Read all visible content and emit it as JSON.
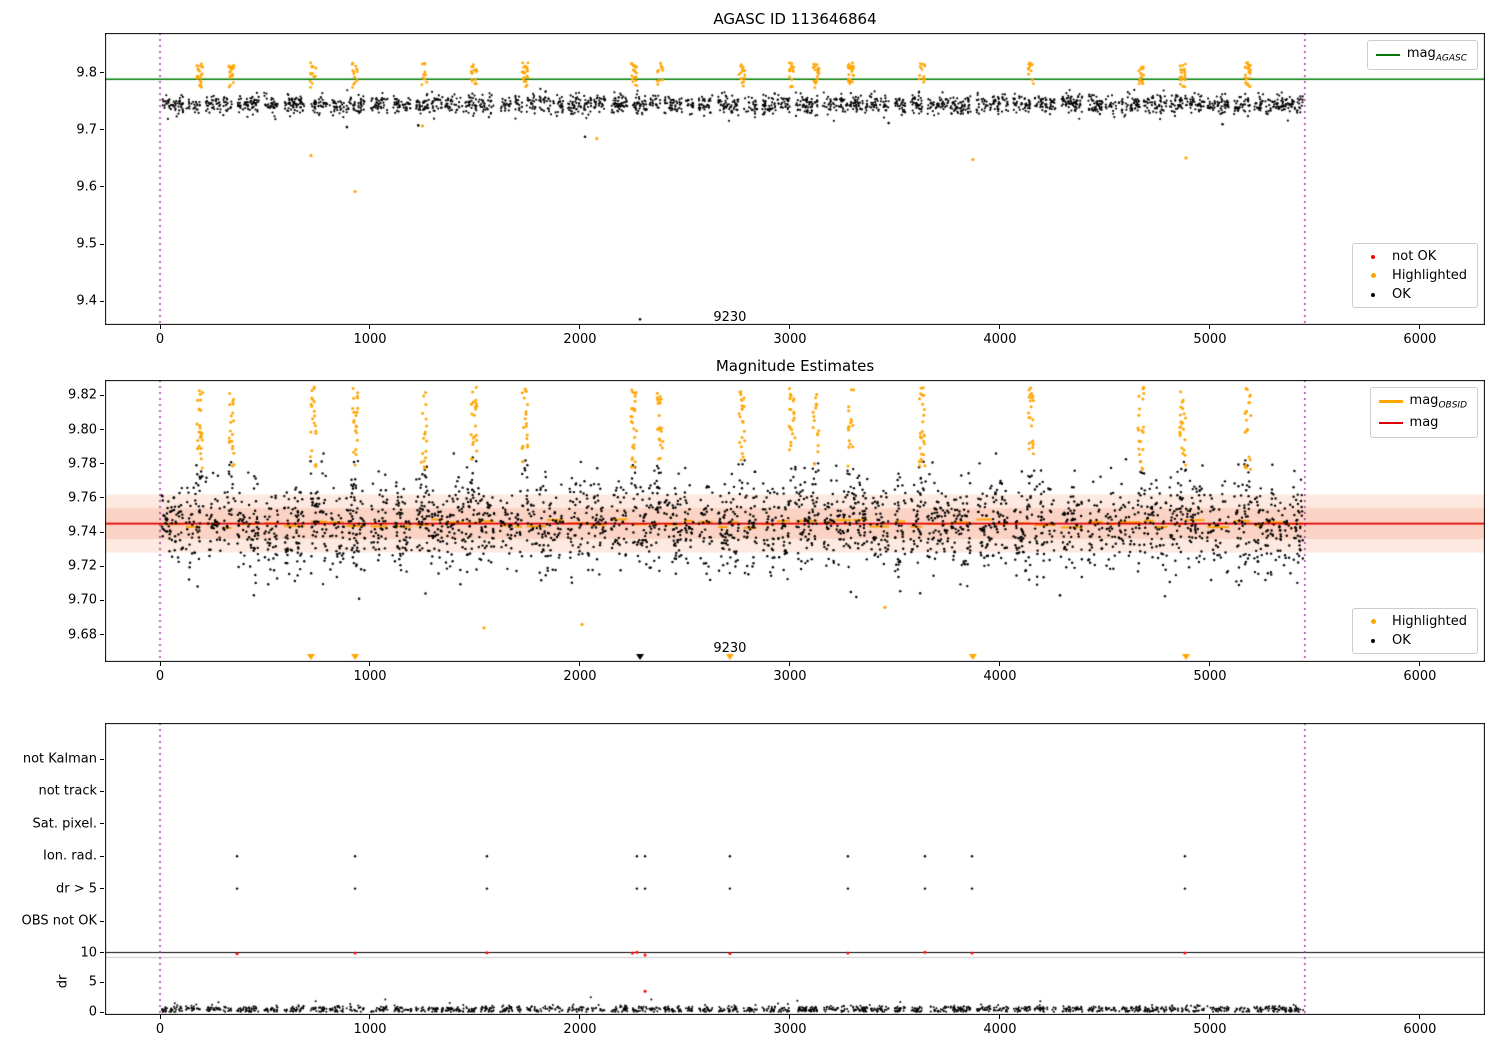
{
  "figure": {
    "background": "#ffffff"
  },
  "colors": {
    "ok_marker": "#000000",
    "highlighted_marker": "#ffa500",
    "not_ok_marker": "#ff0000",
    "agasc_line": "#007a00",
    "mag_line": "#dd0000",
    "obsid_line": "#ffa500",
    "band_outer": "#fde9df",
    "band_inner": "#fbd3c4",
    "vline": "#8b008b",
    "axis": "#000000"
  },
  "obsid_clusters": {
    "x": [
      190,
      343,
      729,
      929,
      1257,
      1495,
      1738,
      2257,
      2381,
      2771,
      3010,
      3124,
      3290,
      3629,
      4148,
      4671,
      4871,
      5181
    ],
    "x_spread": 14,
    "points_per_cluster": 22
  },
  "chart_data": [
    {
      "type": "scatter",
      "title": "AGASC ID 113646864",
      "xlim": [
        -262,
        6310
      ],
      "xticks": [
        0,
        1000,
        2000,
        3000,
        4000,
        5000,
        6000
      ],
      "ylim": [
        9.358,
        9.87
      ],
      "yticks": [
        9.4,
        9.5,
        9.6,
        9.7,
        9.8
      ],
      "ytick_labels": [
        "9.4",
        "9.5",
        "9.6",
        "9.7",
        "9.8"
      ],
      "hline": {
        "label_prefix": "mag",
        "label_sub": "AGASC",
        "value": 9.789,
        "color": "#007a00"
      },
      "vlines": {
        "x": [
          0,
          5452
        ],
        "color": "#8b008b",
        "style": "dotted"
      },
      "annotation": {
        "text": "9230",
        "x": 2714,
        "y": 9.372
      },
      "legend_markers": [
        {
          "label": "not OK",
          "color": "#ff0000"
        },
        {
          "label": "Highlighted",
          "color": "#ffa500"
        },
        {
          "label": "OK",
          "color": "#000000"
        }
      ],
      "series": {
        "ok": {
          "name": "OK",
          "color": "#000000",
          "count": 2300,
          "y_mean": 9.745,
          "y_sigma": 0.0085,
          "y_clip": [
            9.716,
            9.773
          ]
        },
        "highlighted": {
          "name": "Highlighted",
          "color": "#ffa500",
          "y_range": [
            9.773,
            9.818
          ]
        },
        "ok_outliers": [
          [
            2286,
            9.368
          ],
          [
            2024,
            9.688
          ],
          [
            890,
            9.705
          ],
          [
            1230,
            9.708
          ],
          [
            3470,
            9.712
          ],
          [
            5060,
            9.71
          ]
        ],
        "highlighted_outliers": [
          [
            719,
            9.655
          ],
          [
            929,
            9.592
          ],
          [
            1250,
            9.707
          ],
          [
            2080,
            9.685
          ],
          [
            3871,
            9.648
          ],
          [
            4886,
            9.651
          ]
        ]
      }
    },
    {
      "type": "scatter",
      "title": "Magnitude Estimates",
      "xlim": [
        -262,
        6310
      ],
      "xticks": [
        0,
        1000,
        2000,
        3000,
        4000,
        5000,
        6000
      ],
      "ylim": [
        9.664,
        9.829
      ],
      "yticks": [
        9.68,
        9.7,
        9.72,
        9.74,
        9.76,
        9.78,
        9.8,
        9.82
      ],
      "ytick_labels": [
        "9.68",
        "9.70",
        "9.72",
        "9.74",
        "9.76",
        "9.78",
        "9.80",
        "9.82"
      ],
      "hlines": {
        "mag_obsid": {
          "label_prefix": "mag",
          "label_sub": "OBSID",
          "color": "#ffa500"
        },
        "mag": {
          "label_prefix": "mag",
          "label_sub": "",
          "value": 9.745,
          "color": "#dd0000"
        }
      },
      "bands": {
        "outer": [
          9.728,
          9.762
        ],
        "inner": [
          9.736,
          9.754
        ]
      },
      "vlines": {
        "x": [
          0,
          5452
        ],
        "color": "#8b008b",
        "style": "dotted"
      },
      "annotation": {
        "text": "9230",
        "x": 2714,
        "y": 9.672
      },
      "legend_markers": [
        {
          "label": "Highlighted",
          "color": "#ffa500"
        },
        {
          "label": "OK",
          "color": "#000000"
        }
      ],
      "series": {
        "ok": {
          "name": "OK",
          "color": "#000000",
          "count": 2650,
          "y_mean": 9.744,
          "y_sigma": 0.0135,
          "y_clip": [
            9.698,
            9.786
          ]
        },
        "highlighted": {
          "name": "Highlighted",
          "color": "#ffa500",
          "y_range": [
            9.776,
            9.825
          ]
        },
        "ok_outliers": [
          [
            948,
            9.701
          ],
          [
            3290,
            9.705
          ],
          [
            4286,
            9.703
          ]
        ],
        "highlighted_outliers": [
          [
            1543,
            9.684
          ],
          [
            2010,
            9.686
          ],
          [
            3452,
            9.696
          ]
        ]
      },
      "bottom_triangles": [
        {
          "x": 719,
          "color": "#ffa500"
        },
        {
          "x": 929,
          "color": "#ffa500"
        },
        {
          "x": 2286,
          "color": "#000000"
        },
        {
          "x": 2714,
          "color": "#ffa500"
        },
        {
          "x": 3871,
          "color": "#ffa500"
        },
        {
          "x": 4886,
          "color": "#ffa500"
        }
      ]
    },
    {
      "type": "flags",
      "categories": [
        "not Kalman",
        "not track",
        "Sat. pixel.",
        "Ion. rad.",
        "dr > 5",
        "OBS not OK"
      ],
      "dr_label": "dr",
      "dr_ticks": [
        0,
        5,
        10
      ],
      "dr_separator_value": 10,
      "xticks": [
        0,
        1000,
        2000,
        3000,
        4000,
        5000,
        6000
      ],
      "vlines": {
        "x": [
          0,
          5452
        ],
        "color": "#8b008b",
        "style": "dotted"
      },
      "ion_rad_x": [
        367,
        929,
        1557,
        2271,
        2310,
        2714,
        3276,
        3643,
        3867,
        4881
      ],
      "dr_gt5_x": [
        367,
        929,
        1557,
        2271,
        2310,
        2714,
        3276,
        3643,
        3867,
        4881
      ],
      "dr_red_points": [
        [
          367,
          9.8
        ],
        [
          929,
          9.9
        ],
        [
          1557,
          9.95
        ],
        [
          2250,
          9.9
        ],
        [
          2271,
          10.05
        ],
        [
          2310,
          9.6
        ],
        [
          2310,
          3.5
        ],
        [
          2714,
          9.85
        ],
        [
          3276,
          9.9
        ],
        [
          3643,
          10.05
        ],
        [
          3867,
          9.9
        ],
        [
          4881,
          9.9
        ]
      ],
      "dr_ok_scatter": {
        "count": 1500,
        "mean": 0.45,
        "sigma": 0.3,
        "clip": [
          0.05,
          2.8
        ]
      }
    }
  ]
}
